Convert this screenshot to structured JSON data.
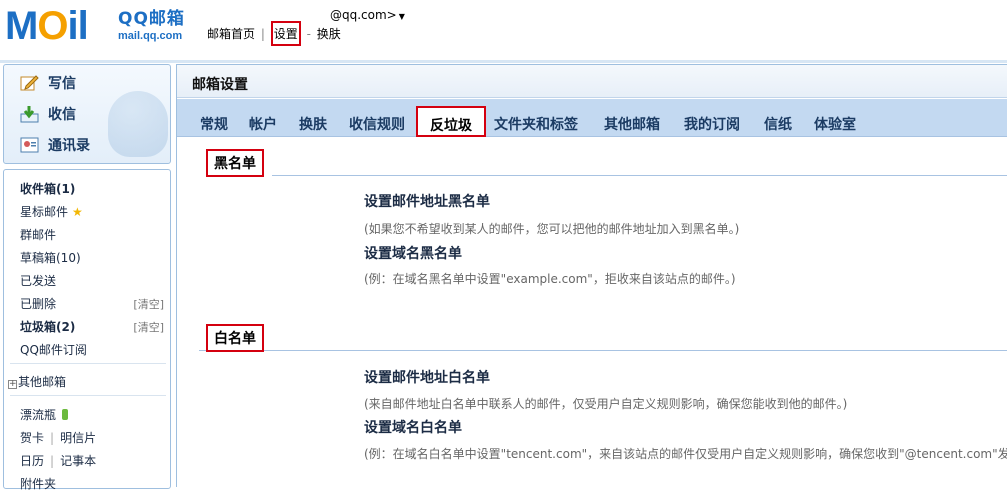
{
  "header": {
    "logo_word_1": "M",
    "logo_word_2": "O",
    "logo_word_3": "il",
    "logo_title": "QQ邮箱",
    "logo_domain": "mail.qq.com",
    "account": "@qq.com>",
    "nav": [
      "邮箱首页",
      "设置",
      "换肤"
    ],
    "nav_sep_1": "|",
    "nav_sep_2": "-"
  },
  "sidebar": {
    "compose": "写信",
    "receive": "收信",
    "contacts": "通讯录",
    "inbox": "收件箱(1)",
    "starred": "星标邮件",
    "group": "群邮件",
    "drafts": "草稿箱(10)",
    "sent": "已发送",
    "deleted": "已删除",
    "spam": "垃圾箱(2)",
    "clear_label": "[清空]",
    "subscription": "QQ邮件订阅",
    "other_mailboxes": "其他邮箱",
    "drift_bottle": "漂流瓶",
    "greeting_card": "贺卡",
    "postcard": "明信片",
    "calendar": "日历",
    "notepad": "记事本",
    "attachments": "附件夹"
  },
  "main": {
    "title": "邮箱设置",
    "tabs": [
      "常规",
      "帐户",
      "换肤",
      "收信规则",
      "反垃圾",
      "文件夹和标签",
      "其他邮箱",
      "我的订阅",
      "信纸",
      "体验室"
    ],
    "active_tab": "反垃圾",
    "blacklist": {
      "label": "黑名单",
      "addr_title": "设置邮件地址黑名单",
      "addr_desc": "(如果您不希望收到某人的邮件，您可以把他的邮件地址加入到黑名单。)",
      "domain_title": "设置域名黑名单",
      "domain_desc": "(例：在域名黑名单中设置\"example.com\"，拒收来自该站点的邮件。)"
    },
    "whitelist": {
      "label": "白名单",
      "addr_title": "设置邮件地址白名单",
      "addr_desc": "(来自邮件地址白名单中联系人的邮件，仅受用户自定义规则影响，确保您能收到他的邮件。)",
      "domain_title": "设置域名白名单",
      "domain_desc": "(例：在域名白名单中设置\"tencent.com\"，来自该站点的邮件仅受用户自定义规则影响，确保您收到\"@tencent.com\"发"
    }
  },
  "colors": {
    "brand_blue": "#1d6fc4",
    "brand_orange": "#f5a000",
    "highlight_red": "#d4000f",
    "tab_bar": "#c3d9f1"
  }
}
